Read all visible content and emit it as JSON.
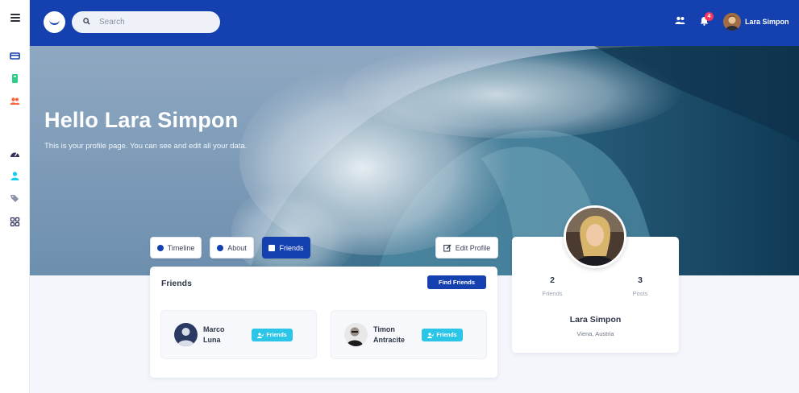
{
  "sidebar": {
    "icons": [
      {
        "name": "credit-card-icon",
        "color": "#1440b0"
      },
      {
        "name": "book-icon",
        "color": "#2dce89"
      },
      {
        "name": "users-icon",
        "color": "#fb6340"
      },
      {
        "name": "dashboard-icon",
        "color": "#32325d"
      },
      {
        "name": "user-icon",
        "color": "#11cdef"
      },
      {
        "name": "tags-icon",
        "color": "#8a92a4"
      },
      {
        "name": "components-icon",
        "color": "#32325d"
      }
    ]
  },
  "topbar": {
    "search_placeholder": "Search",
    "notification_count": "4",
    "user_name": "Lara Simpon",
    "brand_color": "#1440b0"
  },
  "hero": {
    "title": "Hello Lara Simpon",
    "subtitle": "This is your profile page. You can see and edit all your data."
  },
  "tabs": [
    {
      "label": "Timeline",
      "active": false
    },
    {
      "label": "About",
      "active": false
    },
    {
      "label": "Friends",
      "active": true
    }
  ],
  "edit_profile_label": "Edit Profile",
  "friends_card": {
    "title": "Friends",
    "find_button": "Find Friends",
    "friends": [
      {
        "name": "Marco Luna",
        "button": "Friends"
      },
      {
        "name": "Timon Antracite",
        "button": "Friends"
      }
    ]
  },
  "profile_card": {
    "stats": [
      {
        "value": "2",
        "label": "Friends"
      },
      {
        "value": "3",
        "label": "Posts"
      }
    ],
    "name": "Lara Simpon",
    "location": "Viena, Austria"
  }
}
